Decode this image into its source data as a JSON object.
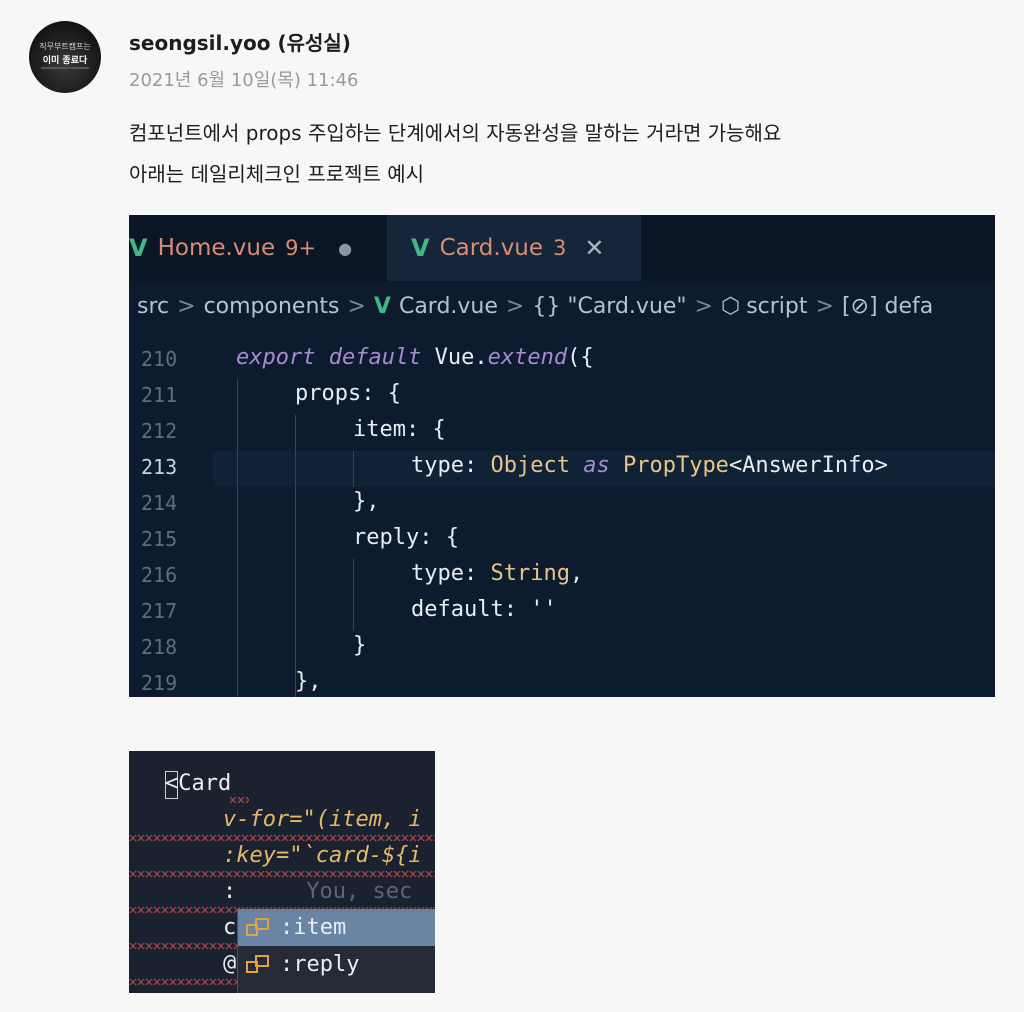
{
  "post": {
    "avatar_text": [
      "직무부트캠프는",
      "이미 종료다"
    ],
    "author": "seongsil.yoo (유성실)",
    "timestamp": "2021년 6월 10일(목) 11:46",
    "message_lines": [
      "컴포넌트에서 props 주입하는 단계에서의 자동완성을 말하는 거라면 가능해요",
      "아래는 데일리체크인 프로젝트 예시"
    ]
  },
  "editor1": {
    "tabs": [
      {
        "icon": "vue-icon",
        "name": "Home.vue",
        "count": "9+",
        "modified": true,
        "active": false
      },
      {
        "icon": "vue-icon",
        "name": "Card.vue",
        "count": "3",
        "modified": false,
        "active": true
      }
    ],
    "breadcrumb": [
      "src",
      "components",
      "Card.vue",
      "{} \"Card.vue\"",
      "script",
      "[⊘] defa"
    ],
    "lines": [
      {
        "n": "210",
        "text": "export default Vue.extend({"
      },
      {
        "n": "211",
        "text": "props: {"
      },
      {
        "n": "212",
        "text": "item: {"
      },
      {
        "n": "213",
        "text": "type: Object as PropType<AnswerInfo>"
      },
      {
        "n": "214",
        "text": "},"
      },
      {
        "n": "215",
        "text": "reply: {"
      },
      {
        "n": "216",
        "text": "type: String,"
      },
      {
        "n": "217",
        "text": "default: ''"
      },
      {
        "n": "218",
        "text": "}"
      },
      {
        "n": "219",
        "text": "},"
      }
    ],
    "current_line": "213"
  },
  "editor2": {
    "lines": [
      "<Card",
      "v-for=\"(item, i",
      ":key=\"`card-${i",
      ":",
      "c",
      "@"
    ],
    "ghost_text": "You, sec",
    "suggestions": [
      ":item",
      ":reply"
    ],
    "selected_suggestion": ":item"
  },
  "colors": {
    "page_bg": "#f7f7f7",
    "editor_bg": "#0c1b2d",
    "vue_green": "#41b883",
    "tab_text": "#d98d74",
    "keyword": "#a989d6",
    "type": "#e8c58a",
    "suggest_selected": "#6a84a6"
  }
}
